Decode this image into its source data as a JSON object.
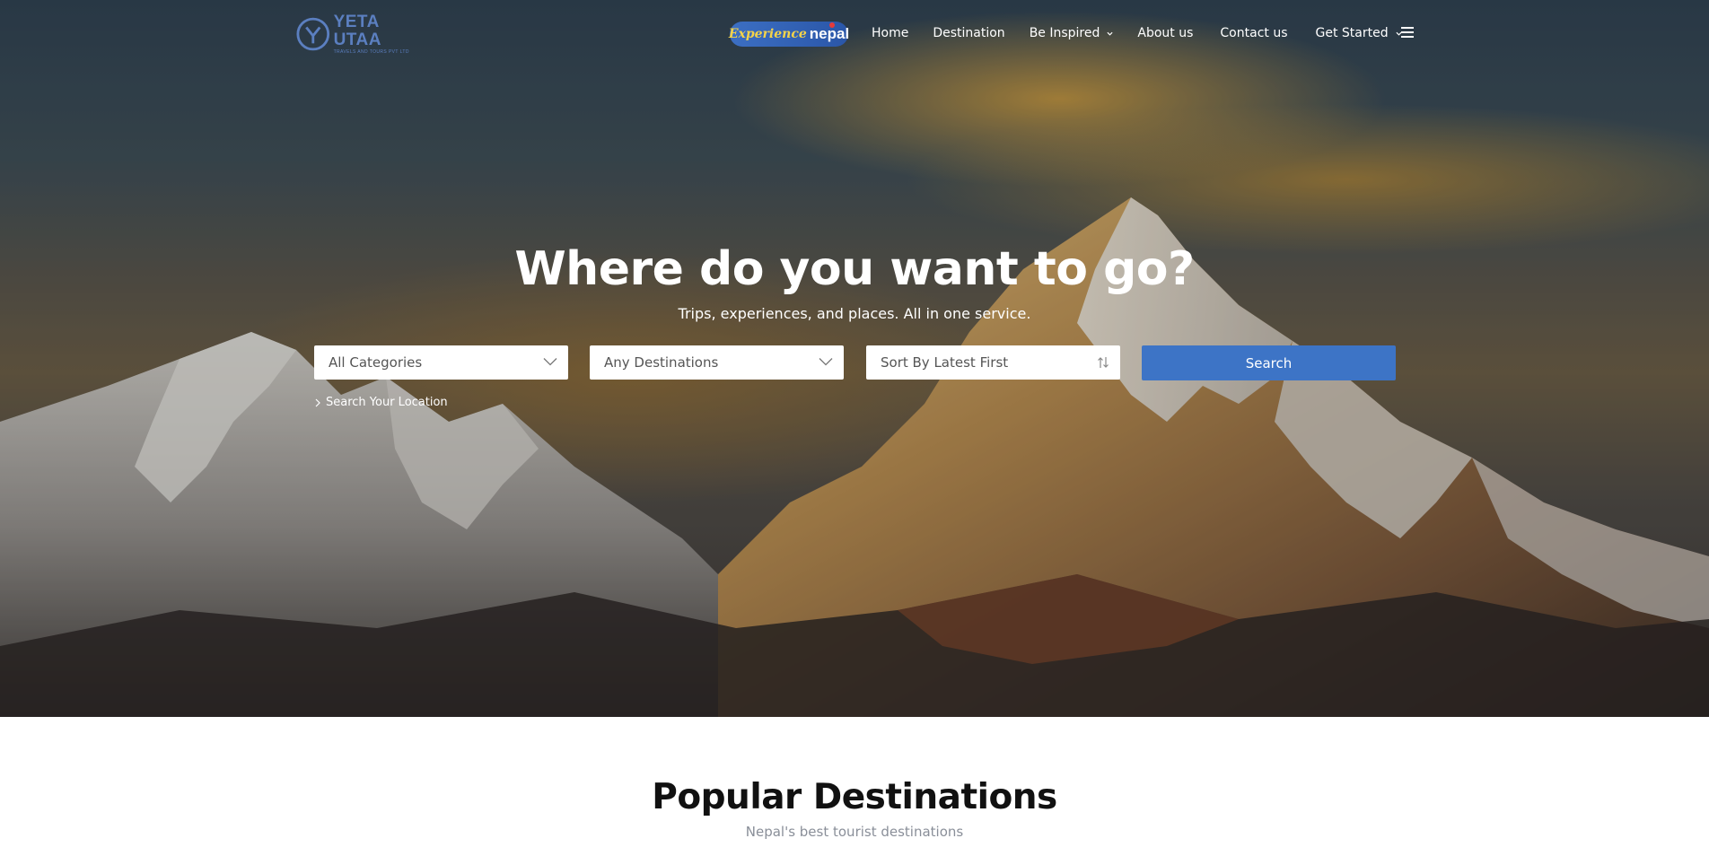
{
  "brand": {
    "name": "YETA UTAA",
    "tagline": "TRAVELS AND TOURS PVT LTD",
    "badge_part1": "Experience",
    "badge_part2": "nepal"
  },
  "nav": {
    "items": [
      {
        "label": "Home",
        "has_dropdown": false
      },
      {
        "label": "Destination",
        "has_dropdown": false
      },
      {
        "label": "Be Inspired",
        "has_dropdown": true
      },
      {
        "label": "About us",
        "has_dropdown": false
      },
      {
        "label": "Contact us",
        "has_dropdown": false
      },
      {
        "label": "Get Started",
        "has_dropdown": true
      }
    ],
    "menu_icon": "hamburger-icon"
  },
  "hero": {
    "title": "Where do you want to go?",
    "subtitle": "Trips, experiences, and places. All in one service."
  },
  "search": {
    "category": "All Categories",
    "destination": "Any Destinations",
    "sort": "Sort By Latest First",
    "button": "Search",
    "location_link": "Search Your Location"
  },
  "popular": {
    "title": "Popular Destinations",
    "subtitle": "Nepal's best tourist destinations"
  },
  "colors": {
    "accent": "#3d74c6",
    "brand": "#5b7fc0"
  }
}
